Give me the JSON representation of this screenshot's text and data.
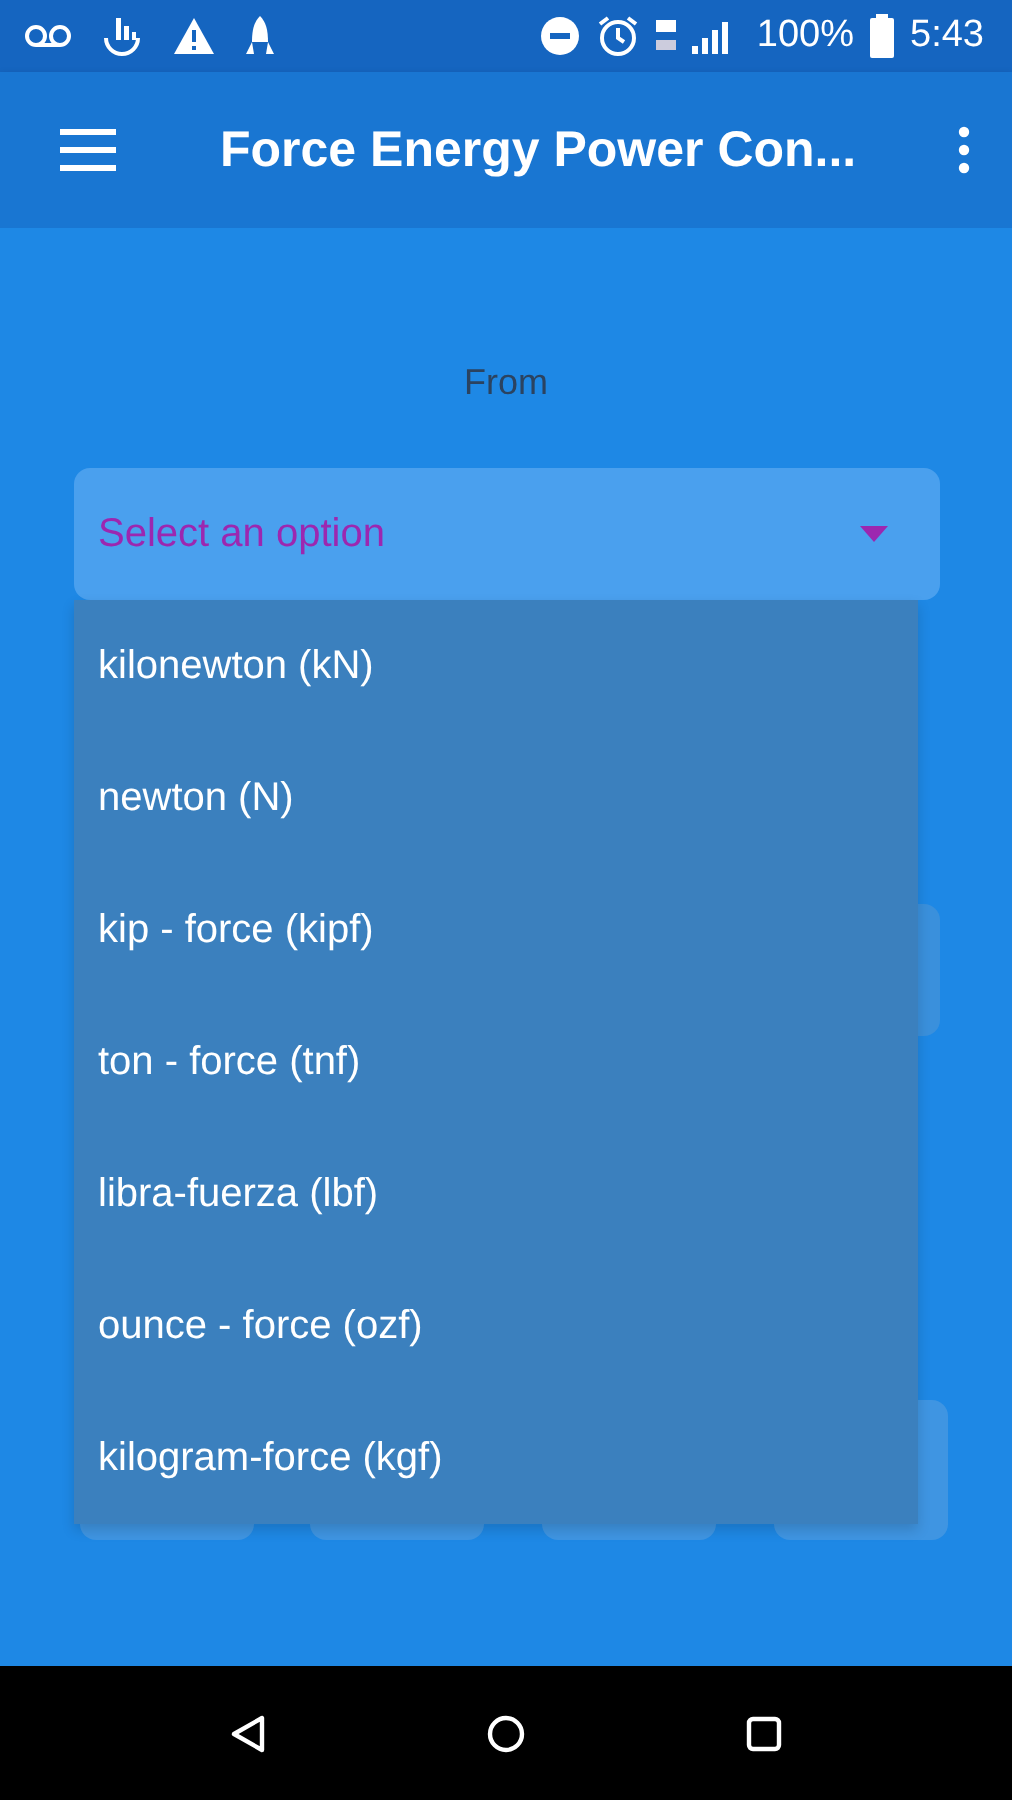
{
  "status_bar": {
    "battery": "100%",
    "time": "5:43"
  },
  "app_bar": {
    "title": "Force Energy Power Con..."
  },
  "from_label": "From",
  "from_select": {
    "placeholder": "Select an option",
    "expanded": true
  },
  "menu": [
    {
      "label": "kilonewton (kN)"
    },
    {
      "label": "newton (N)"
    },
    {
      "label": "kip - force (kipf)"
    },
    {
      "label": "ton - force (tnf)"
    },
    {
      "label": "libra-fuerza (lbf)"
    },
    {
      "label": "ounce - force (ozf)"
    },
    {
      "label": "kilogram-force (kgf)"
    }
  ]
}
